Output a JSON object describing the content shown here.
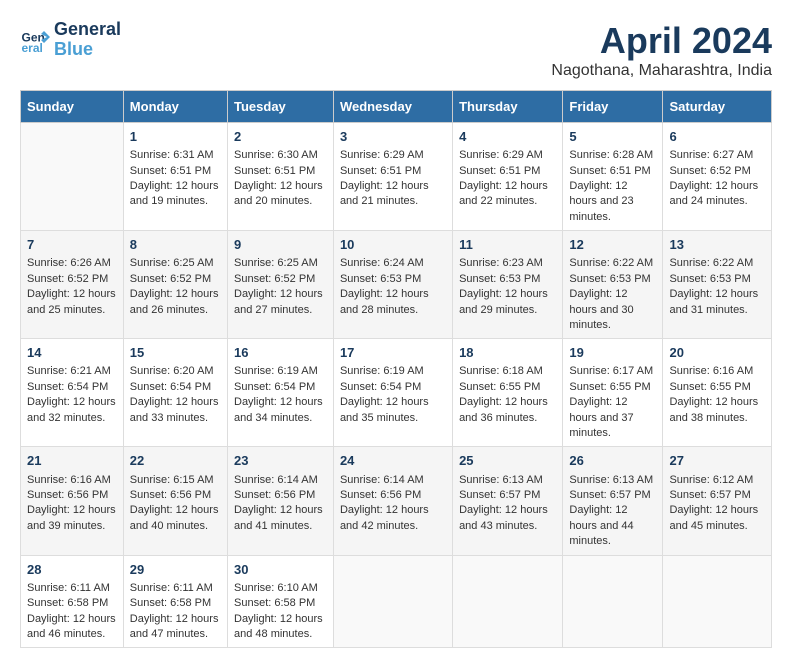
{
  "logo": {
    "line1": "General",
    "line2": "Blue"
  },
  "title": "April 2024",
  "subtitle": "Nagothana, Maharashtra, India",
  "days_of_week": [
    "Sunday",
    "Monday",
    "Tuesday",
    "Wednesday",
    "Thursday",
    "Friday",
    "Saturday"
  ],
  "weeks": [
    [
      {
        "day": "",
        "sunrise": "",
        "sunset": "",
        "daylight": ""
      },
      {
        "day": "1",
        "sunrise": "Sunrise: 6:31 AM",
        "sunset": "Sunset: 6:51 PM",
        "daylight": "Daylight: 12 hours and 19 minutes."
      },
      {
        "day": "2",
        "sunrise": "Sunrise: 6:30 AM",
        "sunset": "Sunset: 6:51 PM",
        "daylight": "Daylight: 12 hours and 20 minutes."
      },
      {
        "day": "3",
        "sunrise": "Sunrise: 6:29 AM",
        "sunset": "Sunset: 6:51 PM",
        "daylight": "Daylight: 12 hours and 21 minutes."
      },
      {
        "day": "4",
        "sunrise": "Sunrise: 6:29 AM",
        "sunset": "Sunset: 6:51 PM",
        "daylight": "Daylight: 12 hours and 22 minutes."
      },
      {
        "day": "5",
        "sunrise": "Sunrise: 6:28 AM",
        "sunset": "Sunset: 6:51 PM",
        "daylight": "Daylight: 12 hours and 23 minutes."
      },
      {
        "day": "6",
        "sunrise": "Sunrise: 6:27 AM",
        "sunset": "Sunset: 6:52 PM",
        "daylight": "Daylight: 12 hours and 24 minutes."
      }
    ],
    [
      {
        "day": "7",
        "sunrise": "Sunrise: 6:26 AM",
        "sunset": "Sunset: 6:52 PM",
        "daylight": "Daylight: 12 hours and 25 minutes."
      },
      {
        "day": "8",
        "sunrise": "Sunrise: 6:25 AM",
        "sunset": "Sunset: 6:52 PM",
        "daylight": "Daylight: 12 hours and 26 minutes."
      },
      {
        "day": "9",
        "sunrise": "Sunrise: 6:25 AM",
        "sunset": "Sunset: 6:52 PM",
        "daylight": "Daylight: 12 hours and 27 minutes."
      },
      {
        "day": "10",
        "sunrise": "Sunrise: 6:24 AM",
        "sunset": "Sunset: 6:53 PM",
        "daylight": "Daylight: 12 hours and 28 minutes."
      },
      {
        "day": "11",
        "sunrise": "Sunrise: 6:23 AM",
        "sunset": "Sunset: 6:53 PM",
        "daylight": "Daylight: 12 hours and 29 minutes."
      },
      {
        "day": "12",
        "sunrise": "Sunrise: 6:22 AM",
        "sunset": "Sunset: 6:53 PM",
        "daylight": "Daylight: 12 hours and 30 minutes."
      },
      {
        "day": "13",
        "sunrise": "Sunrise: 6:22 AM",
        "sunset": "Sunset: 6:53 PM",
        "daylight": "Daylight: 12 hours and 31 minutes."
      }
    ],
    [
      {
        "day": "14",
        "sunrise": "Sunrise: 6:21 AM",
        "sunset": "Sunset: 6:54 PM",
        "daylight": "Daylight: 12 hours and 32 minutes."
      },
      {
        "day": "15",
        "sunrise": "Sunrise: 6:20 AM",
        "sunset": "Sunset: 6:54 PM",
        "daylight": "Daylight: 12 hours and 33 minutes."
      },
      {
        "day": "16",
        "sunrise": "Sunrise: 6:19 AM",
        "sunset": "Sunset: 6:54 PM",
        "daylight": "Daylight: 12 hours and 34 minutes."
      },
      {
        "day": "17",
        "sunrise": "Sunrise: 6:19 AM",
        "sunset": "Sunset: 6:54 PM",
        "daylight": "Daylight: 12 hours and 35 minutes."
      },
      {
        "day": "18",
        "sunrise": "Sunrise: 6:18 AM",
        "sunset": "Sunset: 6:55 PM",
        "daylight": "Daylight: 12 hours and 36 minutes."
      },
      {
        "day": "19",
        "sunrise": "Sunrise: 6:17 AM",
        "sunset": "Sunset: 6:55 PM",
        "daylight": "Daylight: 12 hours and 37 minutes."
      },
      {
        "day": "20",
        "sunrise": "Sunrise: 6:16 AM",
        "sunset": "Sunset: 6:55 PM",
        "daylight": "Daylight: 12 hours and 38 minutes."
      }
    ],
    [
      {
        "day": "21",
        "sunrise": "Sunrise: 6:16 AM",
        "sunset": "Sunset: 6:56 PM",
        "daylight": "Daylight: 12 hours and 39 minutes."
      },
      {
        "day": "22",
        "sunrise": "Sunrise: 6:15 AM",
        "sunset": "Sunset: 6:56 PM",
        "daylight": "Daylight: 12 hours and 40 minutes."
      },
      {
        "day": "23",
        "sunrise": "Sunrise: 6:14 AM",
        "sunset": "Sunset: 6:56 PM",
        "daylight": "Daylight: 12 hours and 41 minutes."
      },
      {
        "day": "24",
        "sunrise": "Sunrise: 6:14 AM",
        "sunset": "Sunset: 6:56 PM",
        "daylight": "Daylight: 12 hours and 42 minutes."
      },
      {
        "day": "25",
        "sunrise": "Sunrise: 6:13 AM",
        "sunset": "Sunset: 6:57 PM",
        "daylight": "Daylight: 12 hours and 43 minutes."
      },
      {
        "day": "26",
        "sunrise": "Sunrise: 6:13 AM",
        "sunset": "Sunset: 6:57 PM",
        "daylight": "Daylight: 12 hours and 44 minutes."
      },
      {
        "day": "27",
        "sunrise": "Sunrise: 6:12 AM",
        "sunset": "Sunset: 6:57 PM",
        "daylight": "Daylight: 12 hours and 45 minutes."
      }
    ],
    [
      {
        "day": "28",
        "sunrise": "Sunrise: 6:11 AM",
        "sunset": "Sunset: 6:58 PM",
        "daylight": "Daylight: 12 hours and 46 minutes."
      },
      {
        "day": "29",
        "sunrise": "Sunrise: 6:11 AM",
        "sunset": "Sunset: 6:58 PM",
        "daylight": "Daylight: 12 hours and 47 minutes."
      },
      {
        "day": "30",
        "sunrise": "Sunrise: 6:10 AM",
        "sunset": "Sunset: 6:58 PM",
        "daylight": "Daylight: 12 hours and 48 minutes."
      },
      {
        "day": "",
        "sunrise": "",
        "sunset": "",
        "daylight": ""
      },
      {
        "day": "",
        "sunrise": "",
        "sunset": "",
        "daylight": ""
      },
      {
        "day": "",
        "sunrise": "",
        "sunset": "",
        "daylight": ""
      },
      {
        "day": "",
        "sunrise": "",
        "sunset": "",
        "daylight": ""
      }
    ]
  ]
}
